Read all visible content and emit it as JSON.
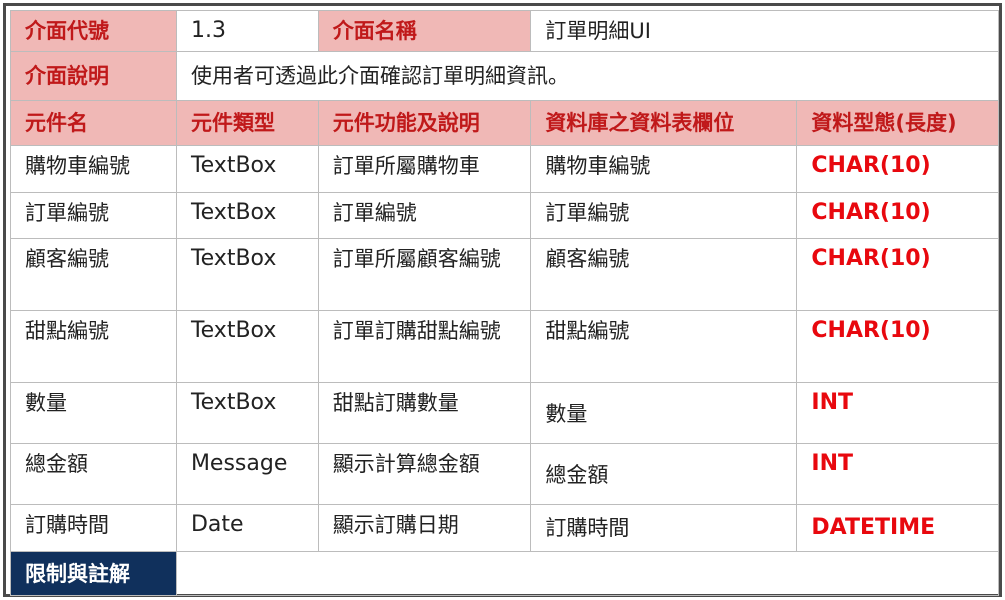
{
  "header": {
    "code_label": "介面代號",
    "code_value": "1.3",
    "name_label": "介面名稱",
    "name_value": "訂單明細UI",
    "desc_label": "介面說明",
    "desc_value": "使用者可透過此介面確認訂單明細資訊。"
  },
  "columns": [
    "元件名",
    "元件類型",
    "元件功能及說明",
    "資料庫之資料表欄位",
    "資料型態(長度)"
  ],
  "rows": [
    {
      "name": "購物車編號",
      "type": "TextBox",
      "func": "訂單所屬購物車",
      "field": "購物車編號",
      "dtype": "CHAR(10)"
    },
    {
      "name": "訂單編號",
      "type": "TextBox",
      "func": "訂單編號",
      "field": "訂單編號",
      "dtype": "CHAR(10)"
    },
    {
      "name": "顧客編號",
      "type": "TextBox",
      "func": "訂單所屬顧客編號",
      "field": "顧客編號",
      "dtype": "CHAR(10)"
    },
    {
      "name": "甜點編號",
      "type": "TextBox",
      "func": "訂單訂購甜點編號",
      "field": "甜點編號",
      "dtype": "CHAR(10)"
    },
    {
      "name": "數量",
      "type": "TextBox",
      "func": "甜點訂購數量",
      "field": "數量",
      "dtype": "INT"
    },
    {
      "name": "總金額",
      "type": "Message",
      "func": "顯示計算總金額",
      "field": "總金額",
      "dtype": "INT"
    },
    {
      "name": "訂購時間",
      "type": "Date",
      "func": "顯示訂購日期",
      "field": "訂購時間",
      "dtype": "DATETIME"
    }
  ],
  "footer": {
    "notes_label": "限制與註解",
    "notes_value": ""
  }
}
